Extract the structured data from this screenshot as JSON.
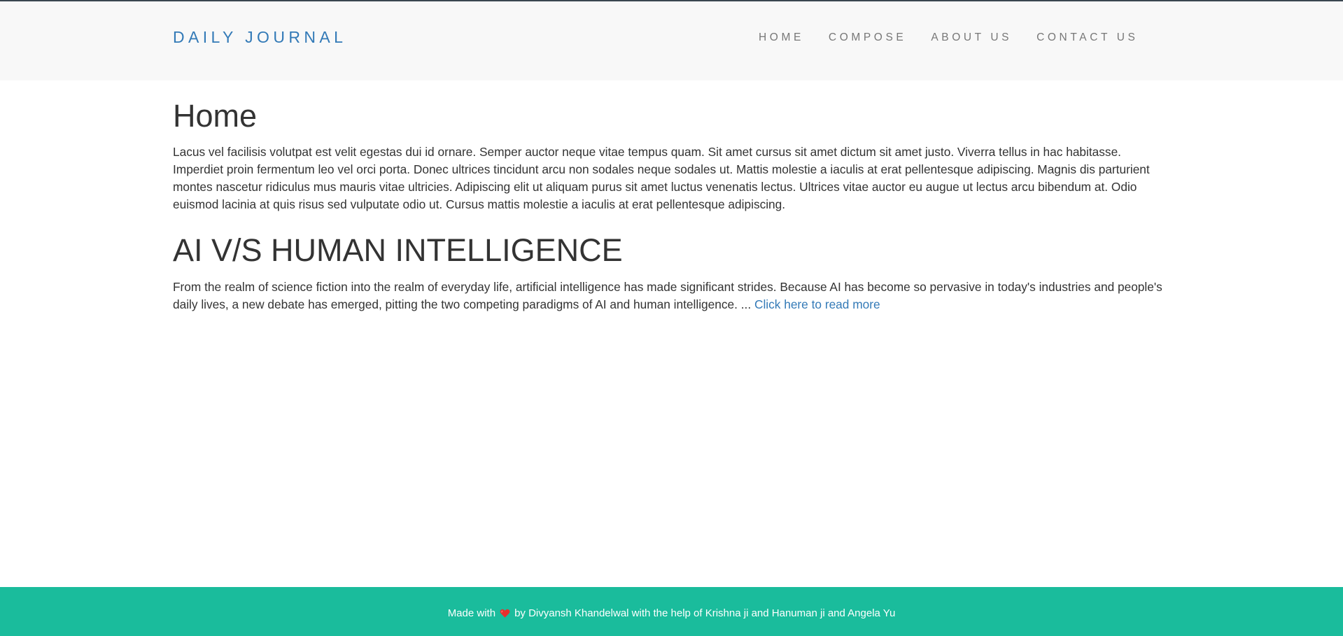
{
  "navbar": {
    "brand": "DAILY JOURNAL",
    "links": [
      "HOME",
      "COMPOSE",
      "ABOUT US",
      "CONTACT US"
    ]
  },
  "home": {
    "title": "Home",
    "content": "Lacus vel facilisis volutpat est velit egestas dui id ornare. Semper auctor neque vitae tempus quam. Sit amet cursus sit amet dictum sit amet justo. Viverra tellus in hac habitasse. Imperdiet proin fermentum leo vel orci porta. Donec ultrices tincidunt arcu non sodales neque sodales ut. Mattis molestie a iaculis at erat pellentesque adipiscing. Magnis dis parturient montes nascetur ridiculus mus mauris vitae ultricies. Adipiscing elit ut aliquam purus sit amet luctus venenatis lectus. Ultrices vitae auctor eu augue ut lectus arcu bibendum at. Odio euismod lacinia at quis risus sed vulputate odio ut. Cursus mattis molestie a iaculis at erat pellentesque adipiscing."
  },
  "post": {
    "title": "AI V/S HUMAN INTELLIGENCE",
    "excerpt": "From the realm of science fiction into the realm of everyday life, artificial intelligence has made significant strides. Because AI has become so pervasive in today's industries and people's daily lives, a new debate has emerged, pitting the two competing paradigms of AI and human intelligence. ...",
    "read_more": "Click here to read more"
  },
  "footer": {
    "prefix": "Made with",
    "heart_icon": "heart-icon",
    "suffix": "by Divyansh Khandelwal with the help of Krishna ji and Hanuman ji and Angela Yu"
  },
  "colors": {
    "brand": "#337ab7",
    "nav_link": "#777777",
    "navbar_bg": "#f8f8f8",
    "footer_bg": "#1abc9c",
    "heart": "#e8302d"
  }
}
